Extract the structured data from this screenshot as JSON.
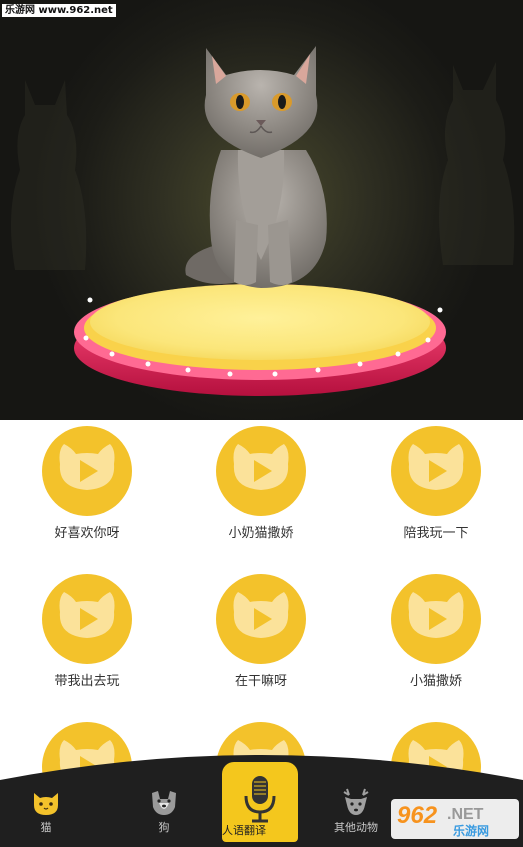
{
  "watermark": "乐游网 www.962.net",
  "colors": {
    "accent": "#f3c22b",
    "tab_bar": "#1f1f1f",
    "platform_rim": "#e0285a",
    "platform_top": "#fbe67a"
  },
  "grid": {
    "items": [
      {
        "label": "好喜欢你呀",
        "icon": "play-icon"
      },
      {
        "label": "小奶猫撒娇",
        "icon": "play-icon"
      },
      {
        "label": "陪我玩一下",
        "icon": "play-icon"
      },
      {
        "label": "带我出去玩",
        "icon": "play-icon"
      },
      {
        "label": "在干嘛呀",
        "icon": "play-icon"
      },
      {
        "label": "小猫撒娇",
        "icon": "play-icon"
      },
      {
        "label": "",
        "icon": "play-icon"
      },
      {
        "label": "",
        "icon": "play-icon"
      },
      {
        "label": "",
        "icon": "play-icon"
      }
    ]
  },
  "tabs": [
    {
      "label": "猫",
      "icon": "cat-icon"
    },
    {
      "label": "狗",
      "icon": "dog-icon"
    },
    {
      "label": "人语翻译",
      "icon": "microphone-icon",
      "selected": true
    },
    {
      "label": "其他动物",
      "icon": "deer-icon"
    }
  ],
  "logo": {
    "text_big": "962",
    "text_net": ".NET",
    "text_sub": "乐游网"
  }
}
